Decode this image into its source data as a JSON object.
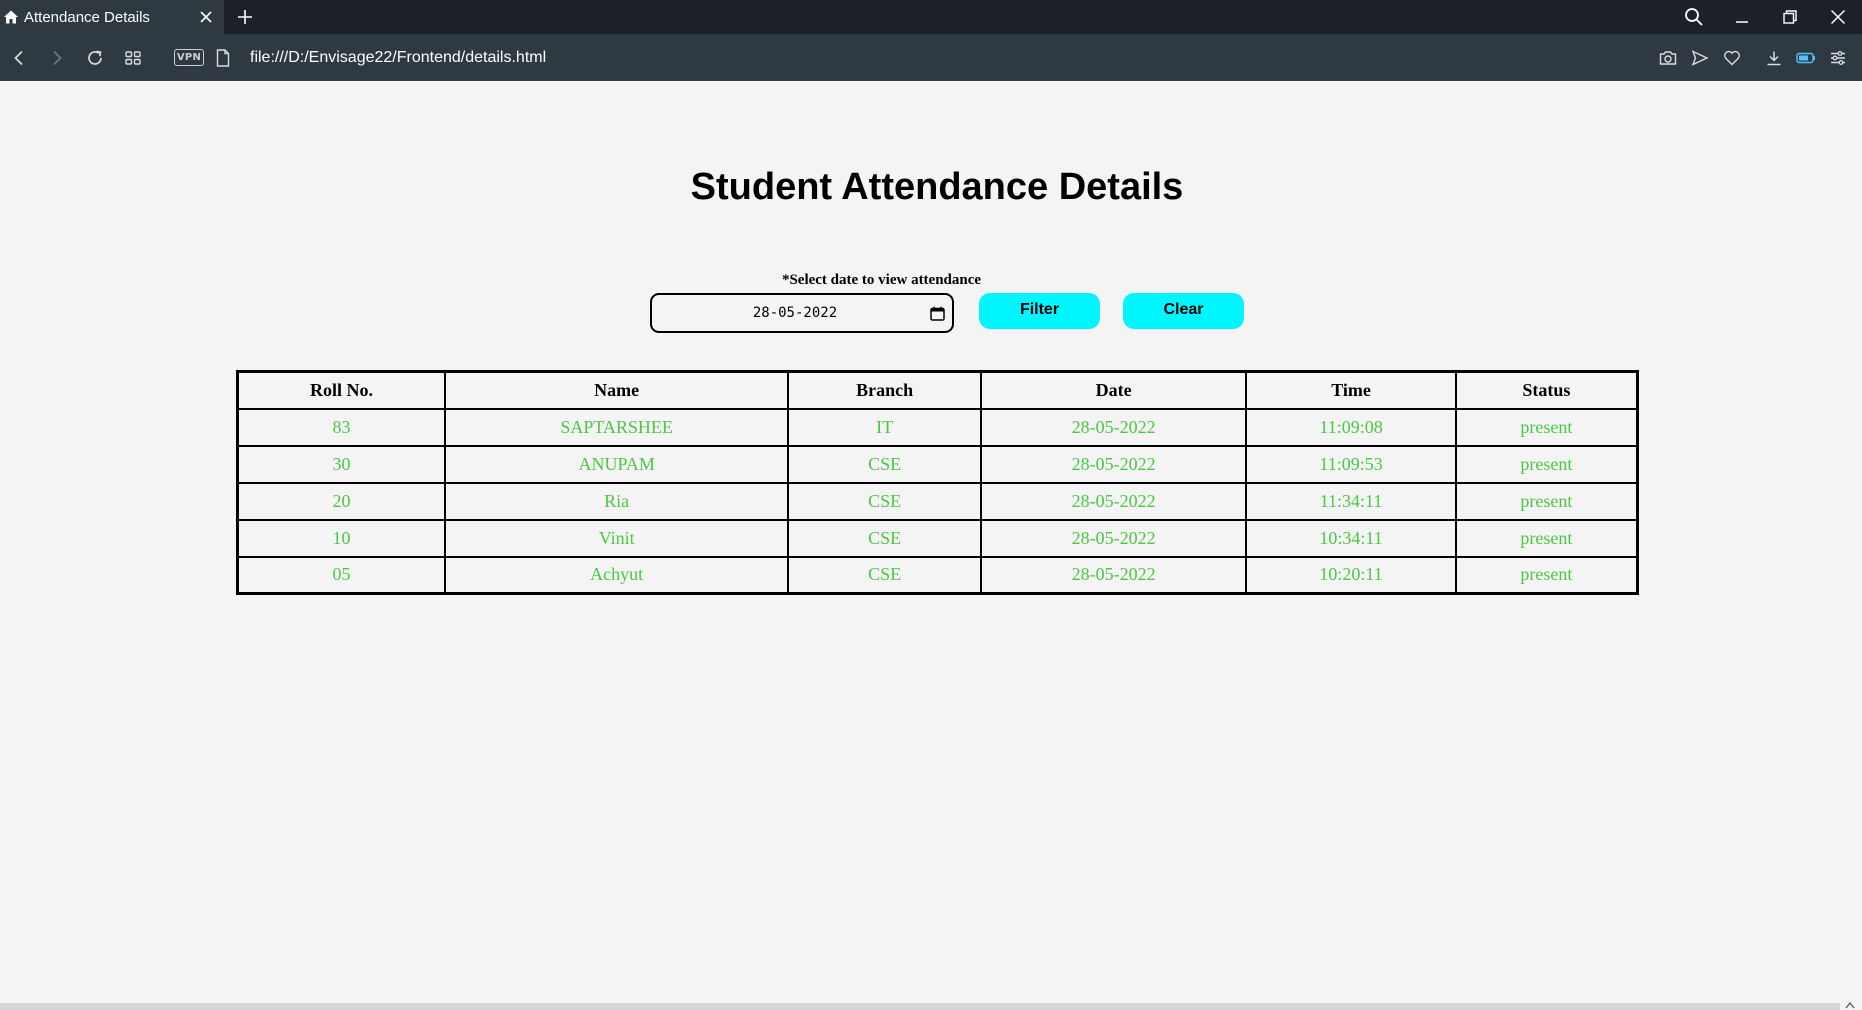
{
  "browser": {
    "tab_title": "Attendance Details",
    "url": "file:///D:/Envisage22/Frontend/details.html",
    "vpn_label": "VPN"
  },
  "page": {
    "title": "Student Attendance Details",
    "filter": {
      "label": "*Select date to view attendance",
      "date_value": "28-05-2022",
      "filter_button": "Filter",
      "clear_button": "Clear"
    },
    "table": {
      "headers": [
        "Roll No.",
        "Name",
        "Branch",
        "Date",
        "Time",
        "Status"
      ],
      "rows": [
        [
          "83",
          "SAPTARSHEE",
          "IT",
          "28-05-2022",
          "11:09:08",
          "present"
        ],
        [
          "30",
          "ANUPAM",
          "CSE",
          "28-05-2022",
          "11:09:53",
          "present"
        ],
        [
          "20",
          "Ria",
          "CSE",
          "28-05-2022",
          "11:34:11",
          "present"
        ],
        [
          "10",
          "Vinit",
          "CSE",
          "28-05-2022",
          "10:34:11",
          "present"
        ],
        [
          "05",
          "Achyut",
          "CSE",
          "28-05-2022",
          "10:20:11",
          "present"
        ]
      ]
    }
  },
  "colors": {
    "accent_button": "#00f6ff",
    "cell_text": "#4cc744",
    "chrome_dark": "#1c2128",
    "chrome": "#2f3942"
  }
}
